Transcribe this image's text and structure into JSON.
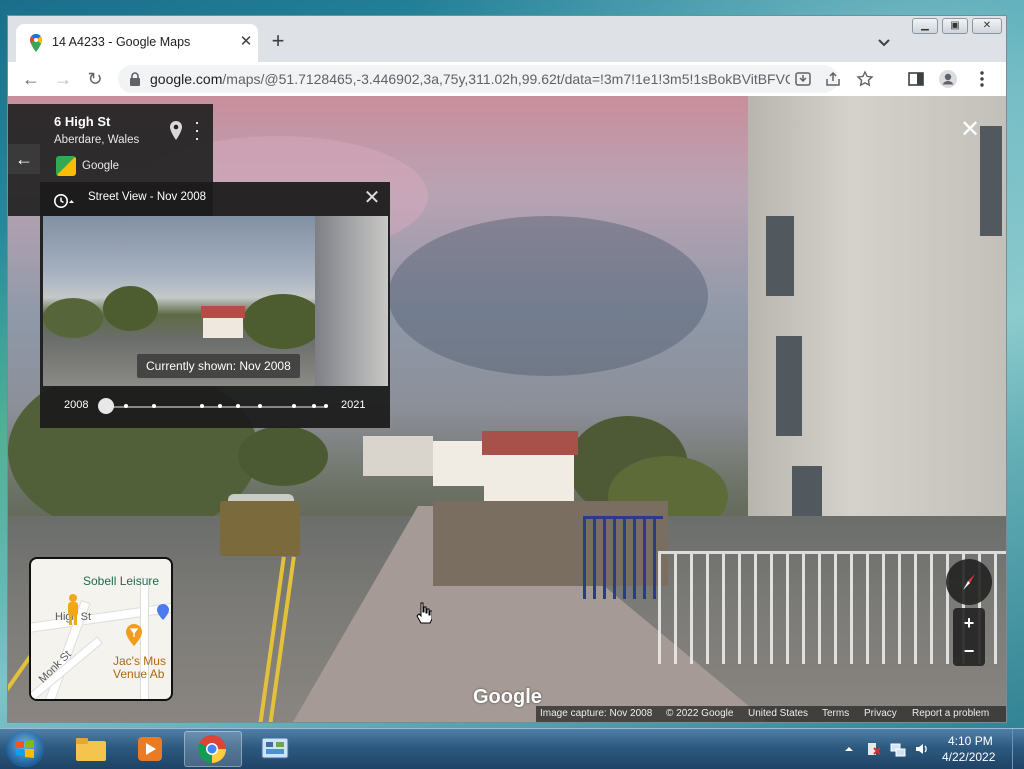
{
  "browser": {
    "tab_title": "14 A4233 - Google Maps",
    "url_host": "google.com",
    "url_rest": "/maps/@51.7128465,-3.446902,3a,75y,311.02h,99.62t/data=!3m7!1e1!3m5!1sBokBVitBFVQ..."
  },
  "place": {
    "name": "6 High St",
    "locality": "Aberdare, Wales",
    "author": "Google"
  },
  "timeline": {
    "title": "Street View - Nov 2008",
    "currently_shown": "Currently shown: Nov 2008",
    "start_year": "2008",
    "end_year": "2021",
    "stops": 10,
    "selected_index": 0
  },
  "minimap": {
    "poi_top": "Sobell Leisure",
    "street_1": "High St",
    "street_2": "Monk St",
    "venue_line1": "Jac's Mus",
    "venue_line2": "Venue Ab"
  },
  "viewer": {
    "logo": "Google",
    "zoom_in": "+",
    "zoom_out": "−",
    "attribution": {
      "capture": "Image capture: Nov 2008",
      "copyright": "© 2022 Google",
      "region": "United States",
      "terms": "Terms",
      "privacy": "Privacy",
      "report": "Report a problem"
    }
  },
  "taskbar": {
    "time": "4:10 PM",
    "date": "4/22/2022"
  },
  "colors": {
    "chrome_tabstrip": "#dee1e6",
    "panel_bg": "#1c1c1c",
    "taskbar": "#2e5a80",
    "curb_yellow": "#e3c13a"
  }
}
